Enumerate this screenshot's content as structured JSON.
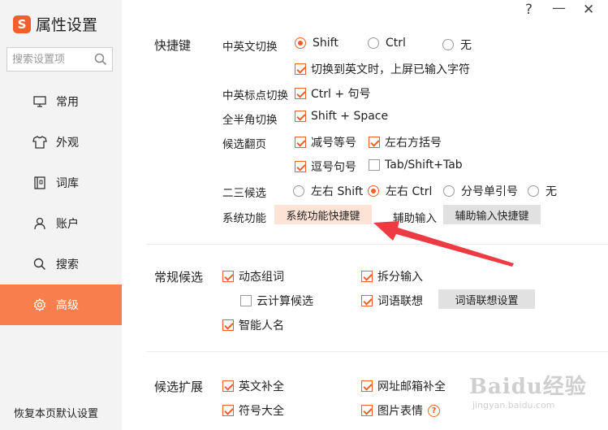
{
  "app": {
    "logo_char": "S",
    "title": "属性设置"
  },
  "window": {
    "help": "?",
    "minimize": "—",
    "close": "✕"
  },
  "sidebar": {
    "search_placeholder": "搜索设置项",
    "items": [
      {
        "label": "常用",
        "icon": "monitor-icon"
      },
      {
        "label": "外观",
        "icon": "shirt-icon"
      },
      {
        "label": "词库",
        "icon": "book-icon"
      },
      {
        "label": "账户",
        "icon": "user-icon"
      },
      {
        "label": "搜索",
        "icon": "search-icon"
      },
      {
        "label": "高级",
        "icon": "gear-icon",
        "active": true
      }
    ],
    "restore": "恢复本页默认设置"
  },
  "shortcuts": {
    "section": "快捷键",
    "cn_en": {
      "label": "中英文切换",
      "options": [
        "Shift",
        "Ctrl",
        "无"
      ],
      "selected": "Shift",
      "commit_option": "切换到英文时，上屏已输入字符",
      "commit_checked": true
    },
    "punct": {
      "label": "中英标点切换",
      "option": "Ctrl + 句号",
      "checked": true
    },
    "width": {
      "label": "全半角切换",
      "option": "Shift + Space",
      "checked": true
    },
    "paging": {
      "label": "候选翻页",
      "options": [
        {
          "label": "减号等号",
          "checked": true
        },
        {
          "label": "左右方括号",
          "checked": true
        },
        {
          "label": "逗号句号",
          "checked": true
        },
        {
          "label": "Tab/Shift+Tab",
          "checked": false
        }
      ]
    },
    "second_third": {
      "label": "二三候选",
      "options": [
        "左右 Shift",
        "左右 Ctrl",
        "分号单引号",
        "无"
      ],
      "selected": "左右 Ctrl"
    },
    "system": {
      "label": "系统功能",
      "button": "系统功能快捷键"
    },
    "assist": {
      "label": "辅助输入",
      "button": "辅助输入快捷键"
    }
  },
  "candidates": {
    "section": "常规候选",
    "options": [
      {
        "label": "动态组词",
        "checked": true
      },
      {
        "label": "拆分输入",
        "checked": true
      },
      {
        "label": "云计算候选",
        "checked": false
      },
      {
        "label": "词语联想",
        "checked": true
      },
      {
        "label": "智能人名",
        "checked": true
      }
    ],
    "assoc_button": "词语联想设置"
  },
  "extension": {
    "section": "候选扩展",
    "options": [
      {
        "label": "英文补全",
        "checked": true
      },
      {
        "label": "网址邮箱补全",
        "checked": true
      },
      {
        "label": "符号大全",
        "checked": true
      },
      {
        "label": "图片表情",
        "checked": true
      }
    ],
    "help": "?"
  },
  "watermark": {
    "brand": "Baidu经验",
    "url": "jingyan.baidu.com"
  },
  "colors": {
    "accent": "#f35f2a",
    "active_nav": "#f87f4d",
    "arrow": "#ee3a43",
    "button_highlight": "#fde2d6"
  }
}
